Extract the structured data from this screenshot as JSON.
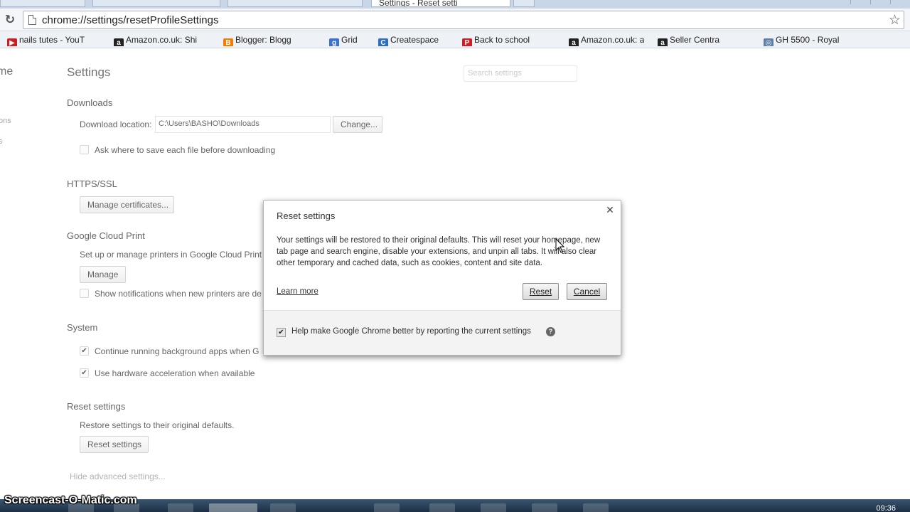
{
  "browser": {
    "tab_title": "Settings - Reset setti",
    "url": "chrome://settings/resetProfileSettings",
    "bookmarks": [
      {
        "label": "nails tutes - YouT",
        "icon": "youtube-icon",
        "color": "#cc1f1f",
        "glyph": "▶"
      },
      {
        "label": "Amazon.co.uk: Shi",
        "icon": "amazon-icon",
        "color": "#222222",
        "glyph": "a"
      },
      {
        "label": "Blogger: Blogg",
        "icon": "blogger-icon",
        "color": "#f57c00",
        "glyph": "B"
      },
      {
        "label": "Grid",
        "icon": "google-icon",
        "color": "#3b6fd4",
        "glyph": "g"
      },
      {
        "label": "Createspace",
        "icon": "createspace-icon",
        "color": "#2c6ec4",
        "glyph": "C"
      },
      {
        "label": "Back to school",
        "icon": "pinterest-icon",
        "color": "#cb2027",
        "glyph": "P"
      },
      {
        "label": "Amazon.co.uk: a",
        "icon": "amazon-icon",
        "color": "#222222",
        "glyph": "a"
      },
      {
        "label": "Seller Centra",
        "icon": "amazon-icon",
        "color": "#222222",
        "glyph": "a"
      },
      {
        "label": "GH 5500 - Royal",
        "icon": "globe-icon",
        "color": "#5d7fa8",
        "glyph": "◎"
      }
    ]
  },
  "settings": {
    "left_nav_title": "me",
    "left_nav_items": [
      "ons",
      "s"
    ],
    "page_title": "Settings",
    "search_placeholder": "Search settings",
    "downloads": {
      "title": "Downloads",
      "location_label": "Download location:",
      "location_value": "C:\\Users\\BASHO\\Downloads",
      "change_label": "Change...",
      "ask_label": "Ask where to save each file before downloading",
      "ask_checked": false
    },
    "https": {
      "title": "HTTPS/SSL",
      "manage_label": "Manage certificates..."
    },
    "cloud_print": {
      "title": "Google Cloud Print",
      "description": "Set up or manage printers in Google Cloud Print",
      "manage_label": "Manage",
      "notify_label": "Show notifications when new printers are de",
      "notify_checked": false
    },
    "system": {
      "title": "System",
      "background_label": "Continue running background apps when G",
      "background_checked": true,
      "hw_label": "Use hardware acceleration when available",
      "hw_checked": true
    },
    "reset": {
      "title": "Reset settings",
      "description": "Restore settings to their original defaults.",
      "button_label": "Reset settings"
    },
    "hide_advanced": "Hide advanced settings..."
  },
  "dialog": {
    "title": "Reset settings",
    "body": "Your settings will be restored to their original defaults. This will reset your homepage, new tab page and search engine, disable your extensions, and unpin all tabs. It will also clear other temporary and cached data, such as cookies, content and site data.",
    "learn_more": "Learn more",
    "reset_label": "Reset",
    "cancel_label": "Cancel",
    "feedback_label": "Help make Google Chrome better by reporting the current settings",
    "feedback_checked": true
  },
  "taskbar": {
    "clock": "09:36",
    "watermark": "Screencast-O-Matic.com"
  }
}
